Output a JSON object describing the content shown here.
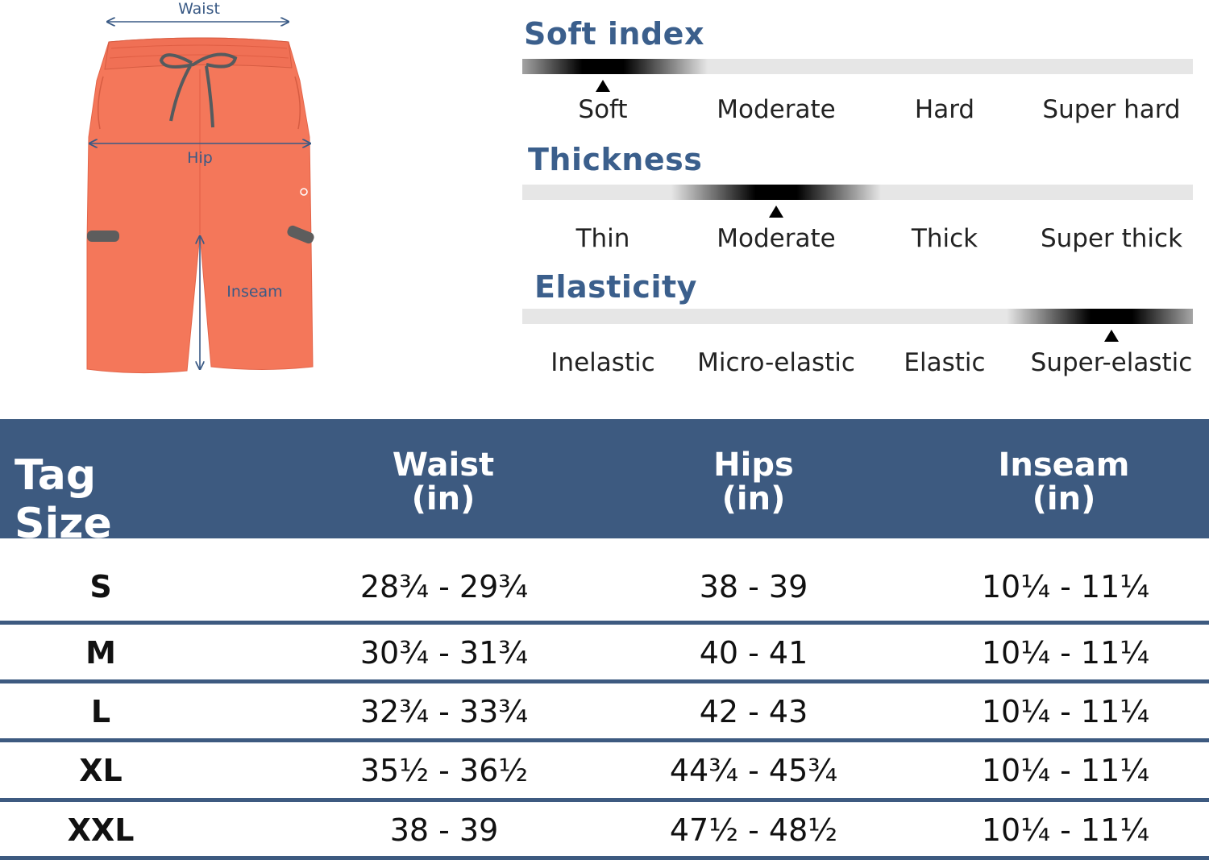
{
  "shorts": {
    "waist_label": "Waist",
    "hip_label": "Hip",
    "inseam_label": "Inseam",
    "color": "#f4775a"
  },
  "scales": [
    {
      "title": "Soft index",
      "options": [
        "Soft",
        "Moderate",
        "Hard",
        "Super hard"
      ],
      "selected_index": 0
    },
    {
      "title": "Thickness",
      "options": [
        "Thin",
        "Moderate",
        "Thick",
        "Super thick"
      ],
      "selected_index": 1
    },
    {
      "title": "Elasticity",
      "options": [
        "Inelastic",
        "Micro-elastic",
        "Elastic",
        "Super-elastic"
      ],
      "selected_index": 3
    }
  ],
  "table": {
    "header_color": "#3d5a80",
    "headers": {
      "tag_size": "Tag Size",
      "waist": "Waist",
      "hips": "Hips",
      "inseam": "Inseam",
      "unit": "(in)"
    },
    "rows": [
      {
        "size": "S",
        "waist": "28¾ - 29¾",
        "hips": "38 - 39",
        "inseam": "10¼ - 11¼"
      },
      {
        "size": "M",
        "waist": "30¾ - 31¾",
        "hips": "40 - 41",
        "inseam": "10¼ - 11¼"
      },
      {
        "size": "L",
        "waist": "32¾ - 33¾",
        "hips": "42 - 43",
        "inseam": "10¼ - 11¼"
      },
      {
        "size": "XL",
        "waist": "35½ - 36½",
        "hips": "44¾ - 45¾",
        "inseam": "10¼ - 11¼"
      },
      {
        "size": "XXL",
        "waist": "38 - 39",
        "hips": "47½ - 48½",
        "inseam": "10¼ - 11¼"
      }
    ]
  }
}
